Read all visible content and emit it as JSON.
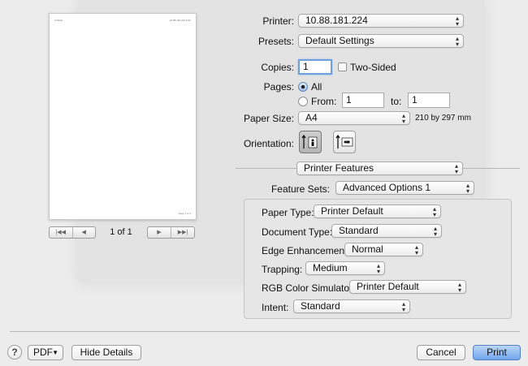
{
  "preview": {
    "page_header_left": "Untitled",
    "page_header_right": "10.88.181.224 Print",
    "page_footer": "Page 1 of 1",
    "page_indicator": "1 of 1"
  },
  "printer": {
    "label": "Printer:",
    "value": "10.88.181.224"
  },
  "presets": {
    "label": "Presets:",
    "value": "Default Settings"
  },
  "copies": {
    "label": "Copies:",
    "value": "1",
    "two_sided_label": "Two-Sided"
  },
  "pages": {
    "label": "Pages:",
    "all_label": "All",
    "from_label": "From:",
    "from_value": "1",
    "to_label": "to:",
    "to_value": "1"
  },
  "paper_size": {
    "label": "Paper Size:",
    "value": "A4",
    "dimensions": "210 by 297 mm"
  },
  "orientation": {
    "label": "Orientation:"
  },
  "section": {
    "value": "Printer Features"
  },
  "feature_sets": {
    "label": "Feature Sets:",
    "value": "Advanced Options 1"
  },
  "features": {
    "paper_type": {
      "label": "Paper Type:",
      "value": "Printer Default"
    },
    "document_type": {
      "label": "Document Type:",
      "value": "Standard"
    },
    "edge_enhancement": {
      "label": "Edge Enhancement:",
      "value": "Normal"
    },
    "trapping": {
      "label": "Trapping:",
      "value": "Medium"
    },
    "rgb_color_simulator": {
      "label": "RGB Color Simulator:",
      "value": "Printer Default"
    },
    "intent": {
      "label": "Intent:",
      "value": "Standard"
    }
  },
  "footer": {
    "help": "?",
    "pdf": "PDF",
    "hide_details": "Hide Details",
    "cancel": "Cancel",
    "print": "Print"
  },
  "colors": {
    "window_bg": "#ececec",
    "default_button": "#6fa5ec",
    "focus_ring": "#6ea0dd"
  },
  "icons": [
    "chevron-updown-icon",
    "first-page-icon",
    "previous-page-icon",
    "next-page-icon",
    "last-page-icon",
    "portrait-orientation-icon",
    "landscape-orientation-icon",
    "dropdown-triangle-icon"
  ]
}
